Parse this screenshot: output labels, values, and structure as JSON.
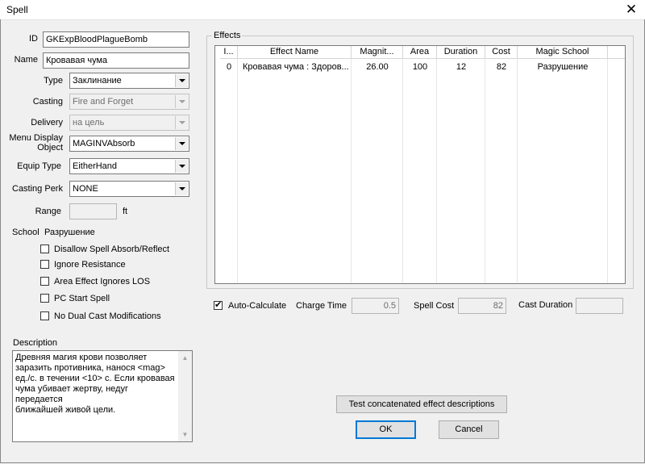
{
  "window": {
    "title": "Spell",
    "close_glyph": "✕"
  },
  "form": {
    "id_label": "ID",
    "id_value": "GKExpBloodPlagueBomb",
    "name_label": "Name",
    "name_value": "Кровавая чума",
    "type_label": "Type",
    "type_value": "Заклинание",
    "casting_label": "Casting",
    "casting_value": "Fire and Forget",
    "delivery_label": "Delivery",
    "delivery_value": "на цель",
    "menu_display_label_line1": "Menu Display",
    "menu_display_label_line2": "Object",
    "menu_display_value": "MAGINVAbsorb",
    "equip_type_label": "Equip Type",
    "equip_type_value": "EitherHand",
    "casting_perk_label": "Casting Perk",
    "casting_perk_value": "NONE",
    "range_label": "Range",
    "range_value": "",
    "range_unit": "ft",
    "school_label": "School",
    "school_value": "Разрушение"
  },
  "checkboxes": [
    {
      "label": "Disallow Spell Absorb/Reflect",
      "checked": false
    },
    {
      "label": "Ignore Resistance",
      "checked": false
    },
    {
      "label": "Area Effect Ignores LOS",
      "checked": false
    },
    {
      "label": "PC Start Spell",
      "checked": false
    },
    {
      "label": "No Dual Cast Modifications",
      "checked": false
    }
  ],
  "description": {
    "label": "Description",
    "text": "Древняя магия крови позволяет\nзаразить противника, нанося <mag>\nед./с. в течении <10> с. Если кровавая\nчума убивает жертву, недуг передается\nближайшей живой цели."
  },
  "effects": {
    "group_label": "Effects",
    "columns": [
      "I...",
      "Effect Name",
      "Magnit...",
      "Area",
      "Duration",
      "Cost",
      "Magic School"
    ],
    "rows": [
      [
        "0",
        "Кровавая чума : Здоров...",
        "26.00",
        "100",
        "12",
        "82",
        "Разрушение"
      ]
    ]
  },
  "calc": {
    "auto_calculate_label": "Auto-Calculate",
    "auto_calculate_checked": true,
    "charge_time_label": "Charge Time",
    "charge_time_value": "0.5",
    "spell_cost_label": "Spell Cost",
    "spell_cost_value": "82",
    "cast_duration_label": "Cast Duration",
    "cast_duration_value": ""
  },
  "buttons": {
    "test_label": "Test concatenated effect descriptions",
    "ok_label": "OK",
    "cancel_label": "Cancel"
  }
}
